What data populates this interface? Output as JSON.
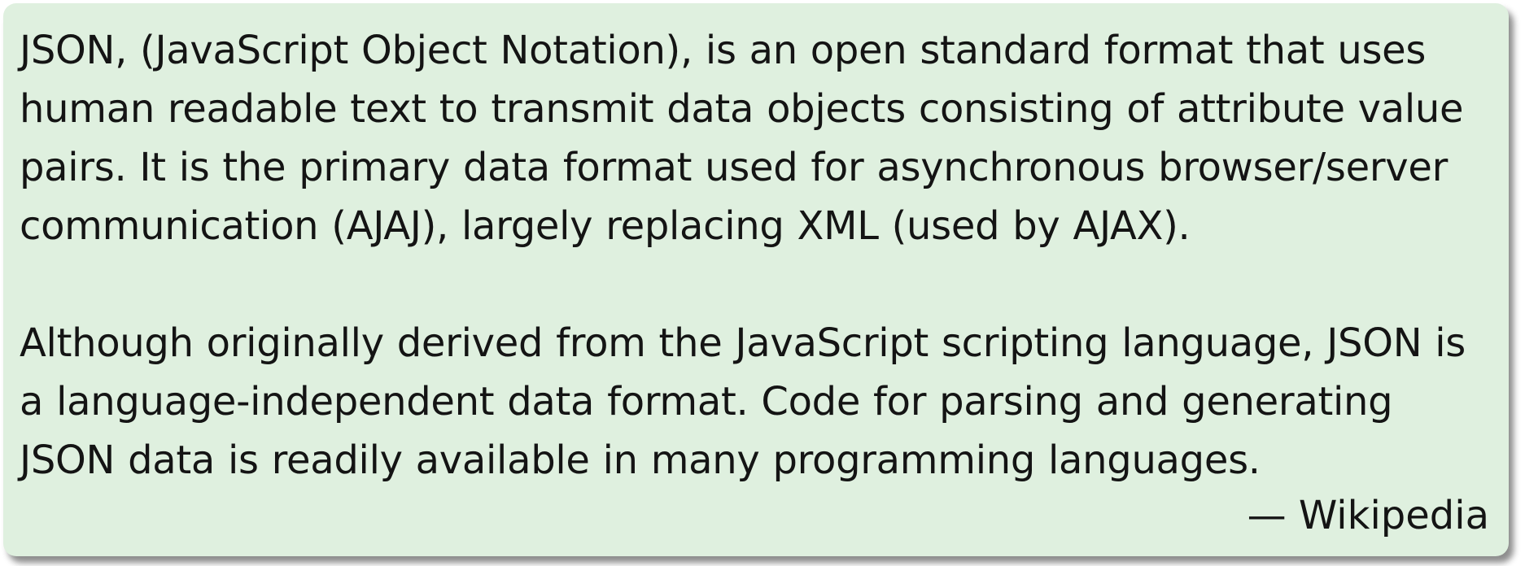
{
  "quote": {
    "paragraphs": [
      "JSON, (JavaScript Object Notation), is an open standard format that uses human readable text to transmit data objects consisting of attribute value pairs. It is the primary data format used for asynchronous browser/server communication (AJAJ), largely replacing XML (used by AJAX).",
      "Although originally derived from the JavaScript scripting language, JSON is a language-independent data format. Code for parsing and generating JSON data is readily available in many programming languages."
    ],
    "attribution": "— Wikipedia"
  },
  "colors": {
    "background": "#dff0df",
    "text": "#141414"
  }
}
